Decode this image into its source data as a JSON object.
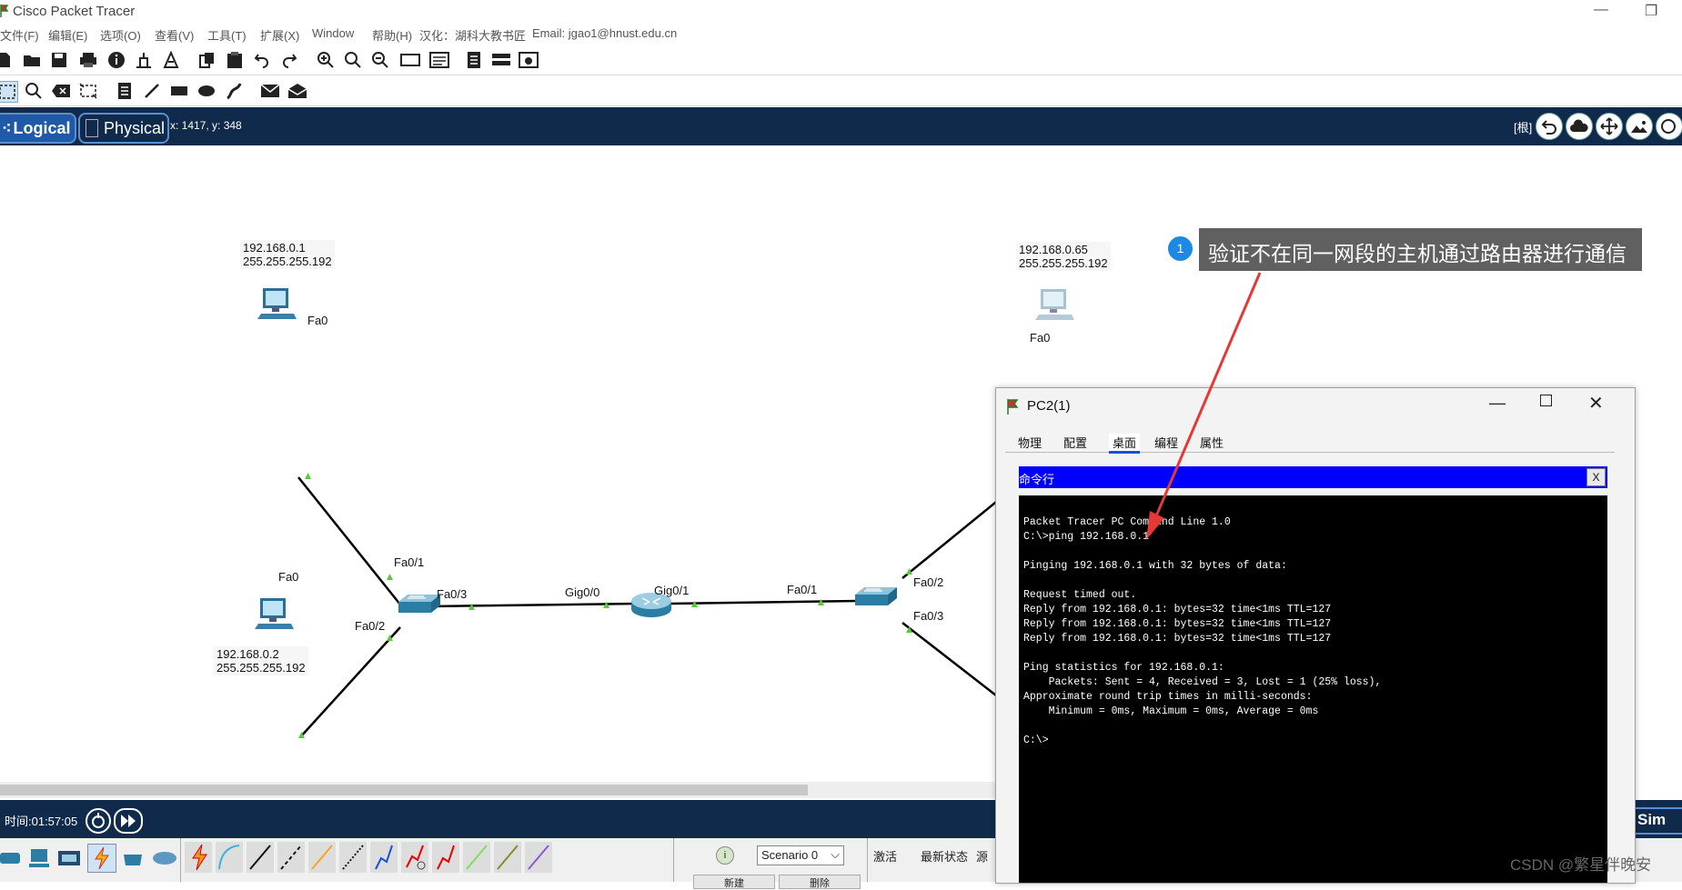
{
  "app": {
    "title": "Cisco Packet Tracer"
  },
  "menu": [
    "文件(F)",
    "编辑(E)",
    "选项(O)",
    "查看(V)",
    "工具(T)",
    "扩展(X)",
    "Window",
    "帮助(H)",
    "汉化：湖科大教书匠",
    "Email: jgao1@hnust.edu.cn"
  ],
  "workspace": {
    "logical_tab": "Logical",
    "physical_tab": "Physical",
    "coords": "x: 1417, y: 348",
    "root_label": "[根]"
  },
  "devices": {
    "pc_top_left": {
      "ip": "192.168.0.1",
      "mask": "255.255.255.192"
    },
    "pc_bottom_left": {
      "ip": "192.168.0.2",
      "mask": "255.255.255.192"
    },
    "pc_top_right": {
      "ip": "192.168.0.65",
      "mask": "255.255.255.192"
    }
  },
  "ports": {
    "pc1_fa0": "Fa0",
    "pc2_fa0": "Fa0",
    "pc3_fa0": "Fa0",
    "sw1_fa01": "Fa0/1",
    "sw1_fa02": "Fa0/2",
    "sw1_fa03": "Fa0/3",
    "router_gig00": "Gig0/0",
    "router_gig01": "Gig0/1",
    "sw2_fa01": "Fa0/1",
    "sw2_fa02": "Fa0/2",
    "sw2_fa03": "Fa0/3"
  },
  "bottom": {
    "time": "时间:01:57:05",
    "scenario": "Scenario 0",
    "activate": "激活",
    "last_status": "最新状态",
    "source": "源",
    "new_btn": "新建",
    "delete_btn": "删除",
    "sim": "Sim"
  },
  "pc_window": {
    "title": "PC2(1)",
    "tabs": [
      "物理",
      "配置",
      "桌面",
      "编程",
      "属性"
    ],
    "active_tab": "桌面",
    "cmd_title": "命令行",
    "close_x": "X",
    "terminal": "Packet Tracer PC Command Line 1.0\nC:\\>ping 192.168.0.1\n\nPinging 192.168.0.1 with 32 bytes of data:\n\nRequest timed out.\nReply from 192.168.0.1: bytes=32 time<1ms TTL=127\nReply from 192.168.0.1: bytes=32 time<1ms TTL=127\nReply from 192.168.0.1: bytes=32 time<1ms TTL=127\n\nPing statistics for 192.168.0.1:\n    Packets: Sent = 4, Received = 3, Lost = 1 (25% loss),\nApproximate round trip times in milli-seconds:\n    Minimum = 0ms, Maximum = 0ms, Average = 0ms\n\nC:\\>"
  },
  "annotation": {
    "number": "1",
    "text": "验证不在同一网段的主机通过路由器进行通信"
  },
  "watermark": "CSDN @繁星伴晚安",
  "colors": {
    "navy": "#102a4c",
    "cmd_blue": "#0000ff",
    "link_green": "#58c93a",
    "arrow_red": "#e53935"
  }
}
